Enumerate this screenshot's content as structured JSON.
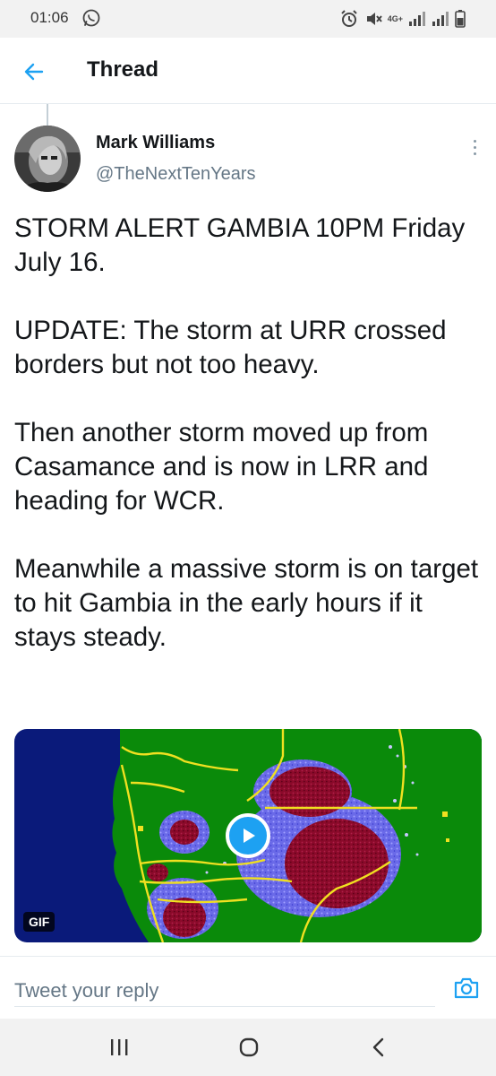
{
  "status_bar": {
    "time": "01:06",
    "network": "4G+",
    "icons": [
      "whatsapp-icon",
      "alarm-icon",
      "mute-icon",
      "signal-icon",
      "battery-icon"
    ]
  },
  "header": {
    "back_icon": "arrow-left-icon",
    "title": "Thread"
  },
  "tweet": {
    "author": {
      "name": "Mark Williams",
      "handle": "@TheNextTenYears"
    },
    "paragraphs": [
      "STORM ALERT GAMBIA 10PM Friday July 16.",
      "UPDATE: The storm at URR crossed borders but not too heavy.",
      "Then another storm moved up from Casamance and is now in LRR and heading for WCR.",
      "Meanwhile a massive storm is on target to hit Gambia in the early hours if it stays steady."
    ],
    "media": {
      "badge": "GIF",
      "play_icon": "play-icon"
    }
  },
  "reply": {
    "placeholder": "Tweet your reply",
    "camera_icon": "camera-icon"
  },
  "nav": {
    "icons": [
      "recent-apps-icon",
      "home-icon",
      "back-icon"
    ]
  },
  "colors": {
    "accent": "#1da1f2",
    "text": "#14171a",
    "secondary_text": "#657786"
  }
}
